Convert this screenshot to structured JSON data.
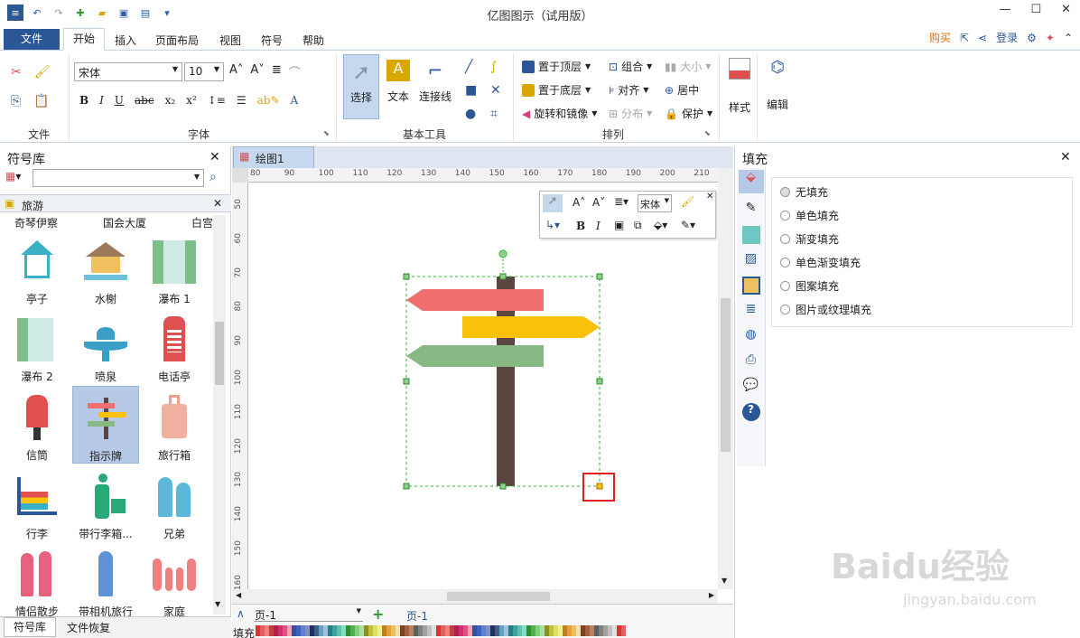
{
  "app": {
    "title": "亿图图示（试用版）"
  },
  "menu": {
    "file": "文件",
    "tabs": [
      "开始",
      "插入",
      "页面布局",
      "视图",
      "符号",
      "帮助"
    ],
    "buy": "购买",
    "login": "登录"
  },
  "ribbon": {
    "groups": {
      "file": "文件",
      "font": "字体",
      "basic_tools": "基本工具",
      "arrange": "排列"
    },
    "font_name": "宋体",
    "font_size": "10",
    "tools": {
      "select": "选择",
      "text": "文本",
      "connector": "连接线"
    },
    "arrange": {
      "bring_front": "置于顶层",
      "send_back": "置于底层",
      "rotate": "旋转和镜像",
      "group": "组合",
      "align": "对齐",
      "distribute": "分布",
      "size": "大小",
      "center": "居中",
      "protect": "保护"
    },
    "style": "样式",
    "edit": "编辑"
  },
  "library": {
    "title": "符号库",
    "category": "旅游",
    "top_labels": [
      "奇琴伊察",
      "国会大厦",
      "白宫"
    ],
    "items": [
      "亭子",
      "水榭",
      "瀑布 1",
      "瀑布 2",
      "喷泉",
      "电话亭",
      "信筒",
      "指示牌",
      "旅行箱",
      "行李",
      "带行李箱...",
      "兄弟",
      "情侣散步",
      "带相机旅行",
      "家庭"
    ],
    "selected": "指示牌",
    "bottom_tabs": [
      "符号库",
      "文件恢复"
    ]
  },
  "document": {
    "tab": "绘图1",
    "ruler_top": [
      "80",
      "90",
      "100",
      "110",
      "120",
      "130",
      "140",
      "150",
      "160",
      "170",
      "180",
      "190",
      "200",
      "210"
    ],
    "ruler_left": [
      "50",
      "60",
      "70",
      "80",
      "90",
      "100",
      "110",
      "120",
      "130",
      "140",
      "150",
      "160"
    ],
    "mini_font": "宋体"
  },
  "fill_panel": {
    "title": "填充",
    "options": [
      "无填充",
      "单色填充",
      "渐变填充",
      "单色渐变填充",
      "图案填充",
      "图片或纹理填充"
    ]
  },
  "status": {
    "page_select": "页-1",
    "page_tab": "页-1",
    "fill_label": "填充"
  },
  "watermark": {
    "brand": "Baidu经验",
    "url": "jingyan.baidu.com"
  },
  "colors": {
    "accent": "#2b5797",
    "sign_red": "#f07070",
    "sign_yellow": "#f9c10a",
    "sign_green": "#88b884",
    "post": "#5a4540"
  }
}
